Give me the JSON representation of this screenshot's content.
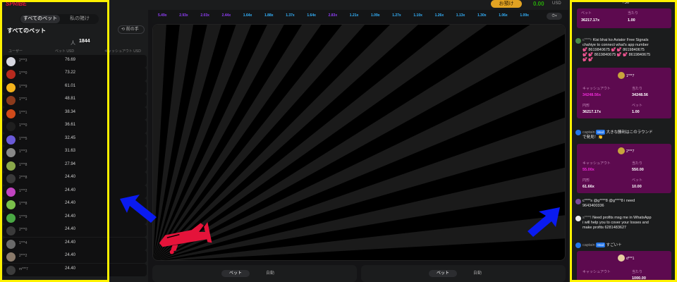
{
  "header": {
    "logo_text": "SPRIBE",
    "deposit_label": "お預け",
    "balance": "0.00",
    "currency": "USD"
  },
  "left_panel": {
    "tabs": [
      {
        "label": "すべてのベット"
      },
      {
        "label": "私の賭け"
      }
    ],
    "title": "すべてのベット",
    "history_label": "前の手",
    "count_prefix": "人",
    "count_value": "1844",
    "columns": {
      "user": "ユーザー",
      "bet": "ベット USD",
      "cashout": "キャッシュアウト USD"
    },
    "rows": [
      {
        "user": "2***3",
        "amount": "76.69",
        "color": "#d7d7e0"
      },
      {
        "user": "1***0",
        "amount": "73.22",
        "color": "#b82a1e"
      },
      {
        "user": "1***9",
        "amount": "61.01",
        "color": "#f2b21c"
      },
      {
        "user": "1***1",
        "amount": "48.81",
        "color": "#8b3a1c"
      },
      {
        "user": "1***1",
        "amount": "38.34",
        "color": "#d04a1a"
      },
      {
        "user": "1***0",
        "amount": "36.61",
        "color": "#1f1f1f"
      },
      {
        "user": "1***5",
        "amount": "32.45",
        "color": "#6a5ad8"
      },
      {
        "user": "1***3",
        "amount": "31.63",
        "color": "#888888"
      },
      {
        "user": "1***8",
        "amount": "27.94",
        "color": "#8aa84a"
      },
      {
        "user": "2***8",
        "amount": "24.40",
        "color": "#3a3a3a"
      },
      {
        "user": "1***2",
        "amount": "24.40",
        "color": "#c044c0"
      },
      {
        "user": "1***8",
        "amount": "24.40",
        "color": "#7ac04a"
      },
      {
        "user": "1***9",
        "amount": "24.40",
        "color": "#4aa844"
      },
      {
        "user": "2***0",
        "amount": "24.40",
        "color": "#3a3a3a"
      },
      {
        "user": "1***4",
        "amount": "24.40",
        "color": "#6a6a6a"
      },
      {
        "user": "2***2",
        "amount": "24.40",
        "color": "#8a7a6a"
      },
      {
        "user": "m***7",
        "amount": "24.40",
        "color": "#3c3c3c"
      }
    ]
  },
  "multipliers": [
    {
      "v": "5.49x",
      "c": "purple"
    },
    {
      "v": "2.93x",
      "c": "purple"
    },
    {
      "v": "2.03x",
      "c": "purple"
    },
    {
      "v": "2.44x",
      "c": "purple"
    },
    {
      "v": "1.64x",
      "c": "blue"
    },
    {
      "v": "1.88x",
      "c": "blue"
    },
    {
      "v": "1.37x",
      "c": "blue"
    },
    {
      "v": "1.64x",
      "c": "blue"
    },
    {
      "v": "2.83x",
      "c": "purple"
    },
    {
      "v": "1.21x",
      "c": "blue"
    },
    {
      "v": "1.09x",
      "c": "blue"
    },
    {
      "v": "1.27x",
      "c": "blue"
    },
    {
      "v": "1.10x",
      "c": "blue"
    },
    {
      "v": "1.26x",
      "c": "blue"
    },
    {
      "v": "1.13x",
      "c": "blue"
    },
    {
      "v": "1.30x",
      "c": "blue"
    },
    {
      "v": "1.06x",
      "c": "blue"
    },
    {
      "v": "1.09x",
      "c": "blue"
    }
  ],
  "bet_panels": [
    {
      "tab_bet": "ベット",
      "tab_auto": "自動"
    },
    {
      "tab_bet": "ベット",
      "tab_auto": "自動"
    }
  ],
  "chat": {
    "top_plus": "+50",
    "card1": {
      "l1": "ベット",
      "v1": "36217.17x",
      "l2": "当たり",
      "v2": "1.00"
    },
    "msg1_user": "c****r",
    "msg1_lines": [
      "Kisi bhai ko Aviator Free Signals",
      "chahiye to connect what's app number",
      "💕 8619840675 💕 💕 8619840675",
      "💕 💕 8619840675 💕 💕 8619840675",
      "💕 💕"
    ],
    "msg1_reply_name": "1***7",
    "card2": {
      "l1": "キャッシュアウト",
      "v1": "34248.56x",
      "l2": "当たり",
      "v2": "34248.56",
      "l3": "円形",
      "v3": "36217.17x",
      "l4": "ベット",
      "v4": "1.00"
    },
    "msg2_user": "captain",
    "msg2_badge": "Mod",
    "msg2_text1": "大きな勝利はこのラウンド",
    "msg2_text2": "で発見！👏",
    "msg2_reply_name": "2***7",
    "card3": {
      "l1": "キャッシュアウト",
      "v1": "55.00x",
      "l2": "当たり",
      "v2": "550.00",
      "l3": "円形",
      "v3": "61.66x",
      "l4": "ベット",
      "v4": "10.00"
    },
    "msg3_line1": "c****s @g****8 @g****8 i need",
    "msg3_line2": "9643400336",
    "msg4_user": "s****l",
    "msg4_lines": [
      "Need profits msg me in WhatsApp",
      "i will help you to cover your losses and",
      "make profits 6281483627"
    ],
    "msg5_user": "captain",
    "msg5_badge": "Mod",
    "msg5_text": "すごい＋",
    "msg5_reply_name": "d***1",
    "card4": {
      "l1": "キャッシュアウト",
      "l2": "当たり",
      "v2": "1000.00"
    }
  }
}
